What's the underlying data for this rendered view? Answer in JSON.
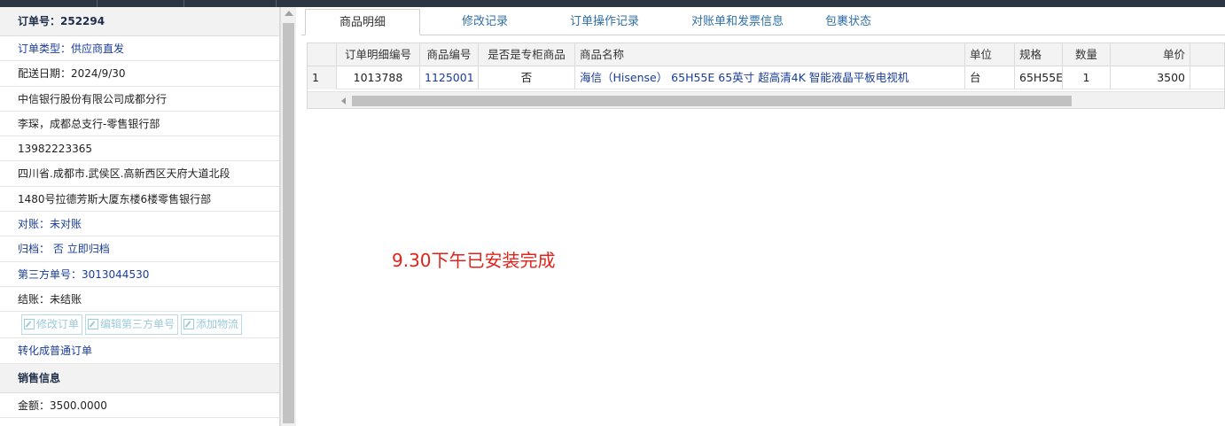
{
  "order": {
    "number_label": "订单号：252294",
    "type_label": "订单类型：供应商直发",
    "delivery_label": "配送日期：2024/9/30",
    "company": "中信银行股份有限公司成都分行",
    "contact": "李琛，成都总支行-零售银行部",
    "phone": "13982223365",
    "address_line1": "四川省.成都市.武侯区.高新西区天府大道北段",
    "address_line2": "1480号拉德芳斯大厦东楼6楼零售银行部",
    "reconcile_label": "对账：未对账",
    "archive_label": "归档：",
    "archive_value": "否",
    "archive_link": "立即归档",
    "third_party_label": "第三方单号：3013044530",
    "settlement_label": "结账：未结账",
    "buttons": {
      "edit_order": "修改订单",
      "edit_third_party": "编辑第三方单号",
      "add_logistics": "添加物流"
    },
    "convert_link": "转化成普通订单"
  },
  "sales": {
    "section_title": "销售信息",
    "amount_label": "金额：3500.0000"
  },
  "tabs": [
    {
      "label": "商品明细",
      "active": true
    },
    {
      "label": "修改记录",
      "active": false
    },
    {
      "label": "订单操作记录",
      "active": false
    },
    {
      "label": "对账单和发票信息",
      "active": false
    },
    {
      "label": "包裹状态",
      "active": false
    }
  ],
  "table": {
    "headers": [
      "",
      "订单明细编号",
      "商品编号",
      "是否是专柜商品",
      "商品名称",
      "单位",
      "规格",
      "数量",
      "单价"
    ],
    "rows": [
      [
        "1",
        "1013788",
        "1125001",
        "否",
        "海信（Hisense） 65H55E 65英寸 超高清4K 智能液晶平板电视机",
        "台",
        "65H55E",
        "1",
        "3500"
      ]
    ]
  },
  "note": "9.30下午已安装完成",
  "colors": {
    "link": "#1a3d9a",
    "tab": "#2f6fa8",
    "note": "#e2231a",
    "topbar": "#2c3542"
  }
}
